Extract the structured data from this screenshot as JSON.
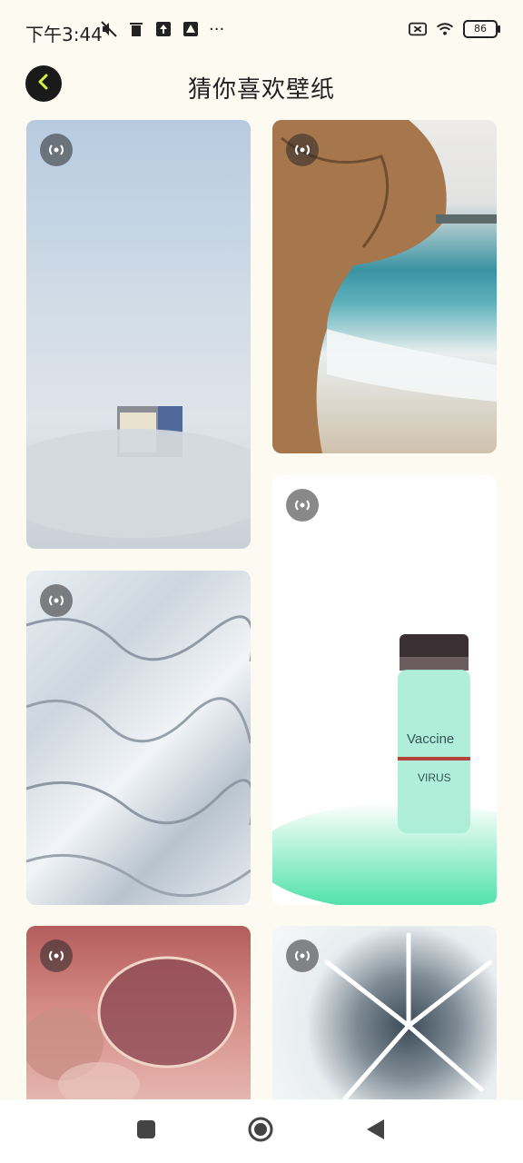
{
  "status": {
    "time": "下午3:44",
    "more": "···",
    "battery": "86"
  },
  "header": {
    "title": "猜你喜欢壁纸",
    "back_icon": "back-arrow-icon"
  },
  "cards": [
    {
      "id": "fog-building",
      "badge_icon": "live-wallpaper-icon"
    },
    {
      "id": "coast-rocks",
      "badge_icon": "live-wallpaper-icon"
    },
    {
      "id": "vaccine-vial",
      "badge_icon": "live-wallpaper-icon",
      "label": "Vaccine",
      "sub": "VIRUS"
    },
    {
      "id": "frozen-surface",
      "badge_icon": "live-wallpaper-icon"
    },
    {
      "id": "wine-glasses",
      "badge_icon": "live-wallpaper-icon"
    },
    {
      "id": "frost-crystals",
      "badge_icon": "live-wallpaper-icon"
    }
  ],
  "colors": {
    "background": "#fdfaf1",
    "accent": "#d6f23a",
    "badge_bg": "#2a2a2a"
  }
}
